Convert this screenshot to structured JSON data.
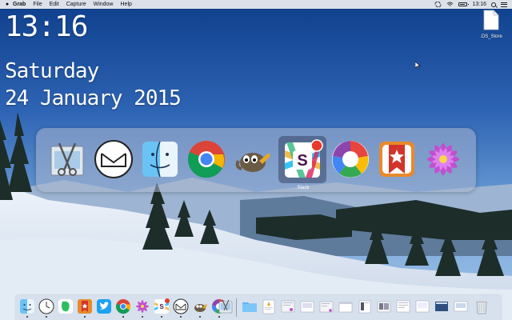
{
  "menubar": {
    "app_name": "Grab",
    "menus": [
      "File",
      "Edit",
      "Capture",
      "Window",
      "Help"
    ],
    "time": "13:16"
  },
  "desktop": {
    "clock": "13:16",
    "day": "Saturday",
    "date": "24 January 2015",
    "file_name": ".DS_Store"
  },
  "switcher": {
    "selected_label": "Slack",
    "apps": [
      "grab-icon",
      "airmail-icon",
      "finder-icon",
      "chrome-icon",
      "gimp-icon",
      "slack-icon",
      "picasa-icon",
      "wunderlist-icon",
      "flower-icon"
    ]
  },
  "dock": {
    "apps": [
      "finder-icon",
      "clock-icon",
      "evernote-icon",
      "wunderlist-icon",
      "twitter-icon",
      "chrome-icon",
      "flower-icon",
      "slack-icon",
      "airmail-icon",
      "gimp-icon",
      "picasa-icon",
      "grab-icon"
    ],
    "documents": [
      "applications-folder-icon",
      "preview-doc-icon",
      "document-icon",
      "document-icon",
      "document-icon",
      "document-icon",
      "document-icon",
      "document-icon",
      "document-icon",
      "document-icon",
      "document-icon",
      "document-icon",
      "document-icon",
      "trash-icon"
    ]
  }
}
